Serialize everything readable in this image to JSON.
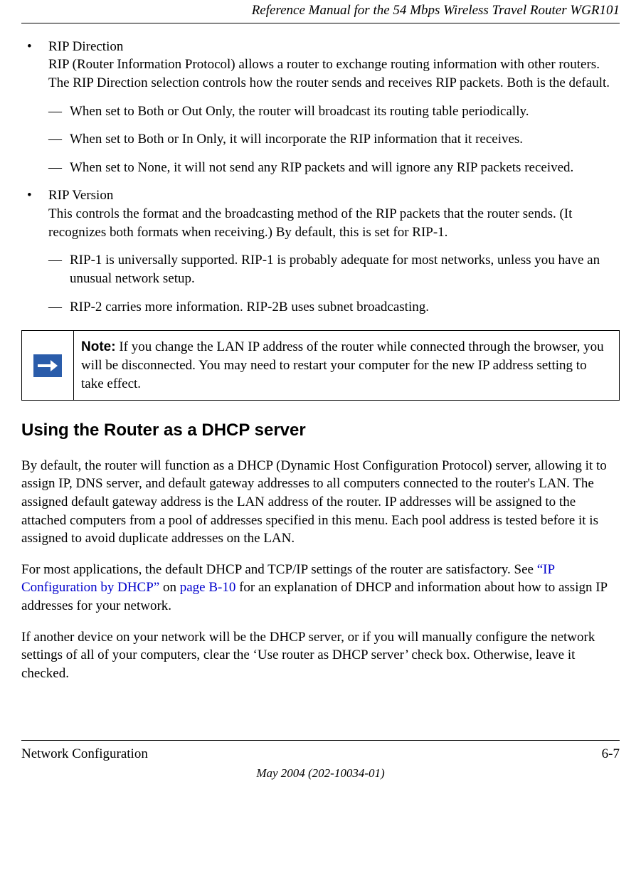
{
  "header": {
    "title": "Reference Manual for the 54 Mbps Wireless Travel Router WGR101"
  },
  "content": {
    "rip_direction": {
      "title": "RIP Direction",
      "body": "RIP (Router Information Protocol) allows a router to exchange routing information with other routers. The RIP Direction selection controls how the router sends and receives RIP packets. Both is the default.",
      "sub": [
        "When set to Both or Out Only, the router will broadcast its routing table periodically.",
        "When set to Both or In Only, it will incorporate the RIP information that it receives.",
        "When set to None, it will not send any RIP packets and will ignore any RIP packets received."
      ]
    },
    "rip_version": {
      "title": "RIP Version",
      "body": "This controls the format and the broadcasting method of the RIP packets that the router sends. (It recognizes both formats when receiving.) By default, this is set for RIP-1.",
      "sub": [
        "RIP-1 is universally supported. RIP-1 is probably adequate for most networks, unless you have an unusual network setup.",
        "RIP-2 carries more information. RIP-2B uses subnet broadcasting."
      ]
    },
    "note": {
      "label": "Note:",
      "text": " If you change the LAN IP address of the router while connected through the browser, you will be disconnected. You may need to restart your computer for the new IP address setting to take effect."
    },
    "dhcp_heading": "Using the Router as a DHCP server",
    "dhcp_p1": "By default, the router will function as a DHCP (Dynamic Host Configuration Protocol) server, allowing it to assign IP, DNS server, and default gateway addresses to all computers connected to the router's LAN. The assigned default gateway address is the LAN address of the router. IP addresses will be assigned to the attached computers from a pool of addresses specified in this menu. Each pool address is tested before it is assigned to avoid duplicate addresses on the LAN.",
    "dhcp_p2_a": "For most applications, the default DHCP and TCP/IP settings of the router are satisfactory. See ",
    "dhcp_p2_link1_a": "“IP Configuration by DHCP”",
    "dhcp_p2_b": " on ",
    "dhcp_p2_link2": "page B-10",
    "dhcp_p2_c": " for an explanation of DHCP and information about how to assign IP addresses for your network.",
    "dhcp_p3": "If another device on your network will be the DHCP server, or if you will manually configure the network settings of all of your computers, clear the ‘Use router as DHCP server’ check box. Otherwise, leave it checked."
  },
  "footer": {
    "section": "Network Configuration",
    "page": "6-7",
    "date": "May 2004 (202-10034-01)"
  }
}
